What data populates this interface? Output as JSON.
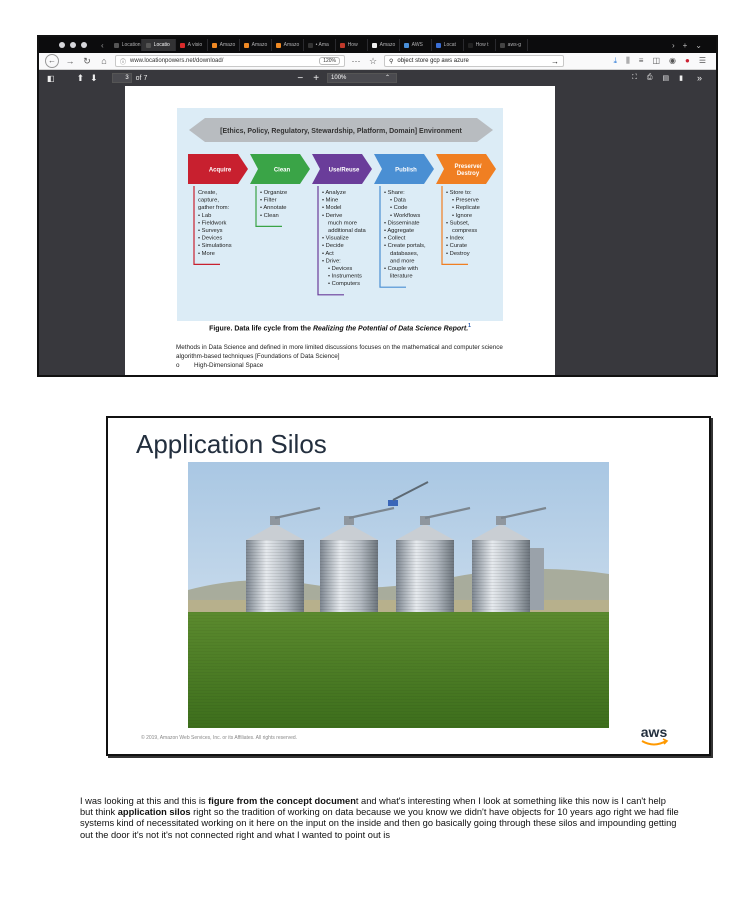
{
  "browser": {
    "tabs": [
      {
        "label": "Location:",
        "fav": "#555"
      },
      {
        "label": "Locatio",
        "fav": "#555",
        "active": true
      },
      {
        "label": "A visio",
        "fav": "#d92b2b"
      },
      {
        "label": "Amazo",
        "fav": "#f08a24"
      },
      {
        "label": "Amazo",
        "fav": "#f08a24"
      },
      {
        "label": "Amazo",
        "fav": "#f08a24"
      },
      {
        "label": "• Ama",
        "fav": "#333"
      },
      {
        "label": "How",
        "fav": "#c0392b"
      },
      {
        "label": "Amazo",
        "fav": "#eeeeee"
      },
      {
        "label": "AWS",
        "fav": "#4a90d9"
      },
      {
        "label": "Locat",
        "fav": "#3b6fd6"
      },
      {
        "label": "How t",
        "fav": "#222"
      },
      {
        "label": "aws-g",
        "fav": "#444"
      }
    ],
    "url": "www.locationpowers.net/download/",
    "zoom": "120%",
    "search_query": "object store gcp aws azure"
  },
  "pdf_viewer": {
    "page_current": "3",
    "page_total": "of 7",
    "zoom": "100%"
  },
  "lifecycle_figure": {
    "environment_label": "[Ethics, Policy, Regulatory, Stewardship, Platform, Domain] Environment",
    "stages": [
      {
        "name": "Acquire",
        "color": "#c8202f",
        "lines": [
          "Create,",
          "capture,",
          "gather from:",
          "• Lab",
          "• Fieldwork",
          "• Surveys",
          "• Devices",
          "• Simulations",
          "• More"
        ]
      },
      {
        "name": "Clean",
        "color": "#3aa447",
        "lines": [
          "• Organize",
          "• Filter",
          "• Annotate",
          "• Clean"
        ]
      },
      {
        "name": "Use/Reuse",
        "color": "#6a3d9a",
        "lines": [
          "• Analyze",
          "• Mine",
          "• Model",
          "• Derive",
          "  much more",
          "  additional data",
          "• Visualize",
          "• Decide",
          "• Act",
          "• Drive:",
          "  • Devices",
          "  • Instruments",
          "  • Computers"
        ]
      },
      {
        "name": "Publish",
        "color": "#4a8fd3",
        "lines": [
          "• Share:",
          "  • Data",
          "  • Code",
          "  • Workflows",
          "• Disseminate",
          "• Aggregate",
          "• Collect",
          "• Create portals,",
          "  databases,",
          "  and more",
          "• Couple with",
          "  literature"
        ]
      },
      {
        "name": "Preserve/\nDestroy",
        "color": "#f07f22",
        "lines": [
          "• Store to:",
          "  • Preserve",
          "  • Replicate",
          "  • Ignore",
          "• Subset,",
          "  compress",
          "• Index",
          "• Curate",
          "• Destroy"
        ]
      }
    ]
  },
  "pdf_text": {
    "caption_prefix": "Figure. Data life cycle from the ",
    "caption_title": "Realizing the Potential of Data Science Report.",
    "caption_ref": "1",
    "paragraph": "Methods in Data Science and defined in more limited discussions focuses on the mathematical and computer science algorithm-based techniques [Foundations of Data Science]",
    "bullet_marker": "o",
    "bullet": "High-Dimensional Space"
  },
  "slide": {
    "title": "Application Silos",
    "copyright": "© 2019, Amazon Web Services, Inc. or its Affiliates. All rights reserved.",
    "logo_text": "aws"
  },
  "transcript": {
    "part1": "I was looking at this and this is ",
    "bold1": "figure from the concept documen",
    "part2": "t and what's interesting when I look at something like this now is I can't help but think ",
    "bold2": "application silos",
    "part3": " right so the tradition of working on data because we you know we didn't have objects for 10 years ago right we had file systems kind of necessitated working on it here on the input on the inside and then go basically going through these silos and impounding getting out the door it's not it's not connected right and what I wanted to point out is"
  }
}
